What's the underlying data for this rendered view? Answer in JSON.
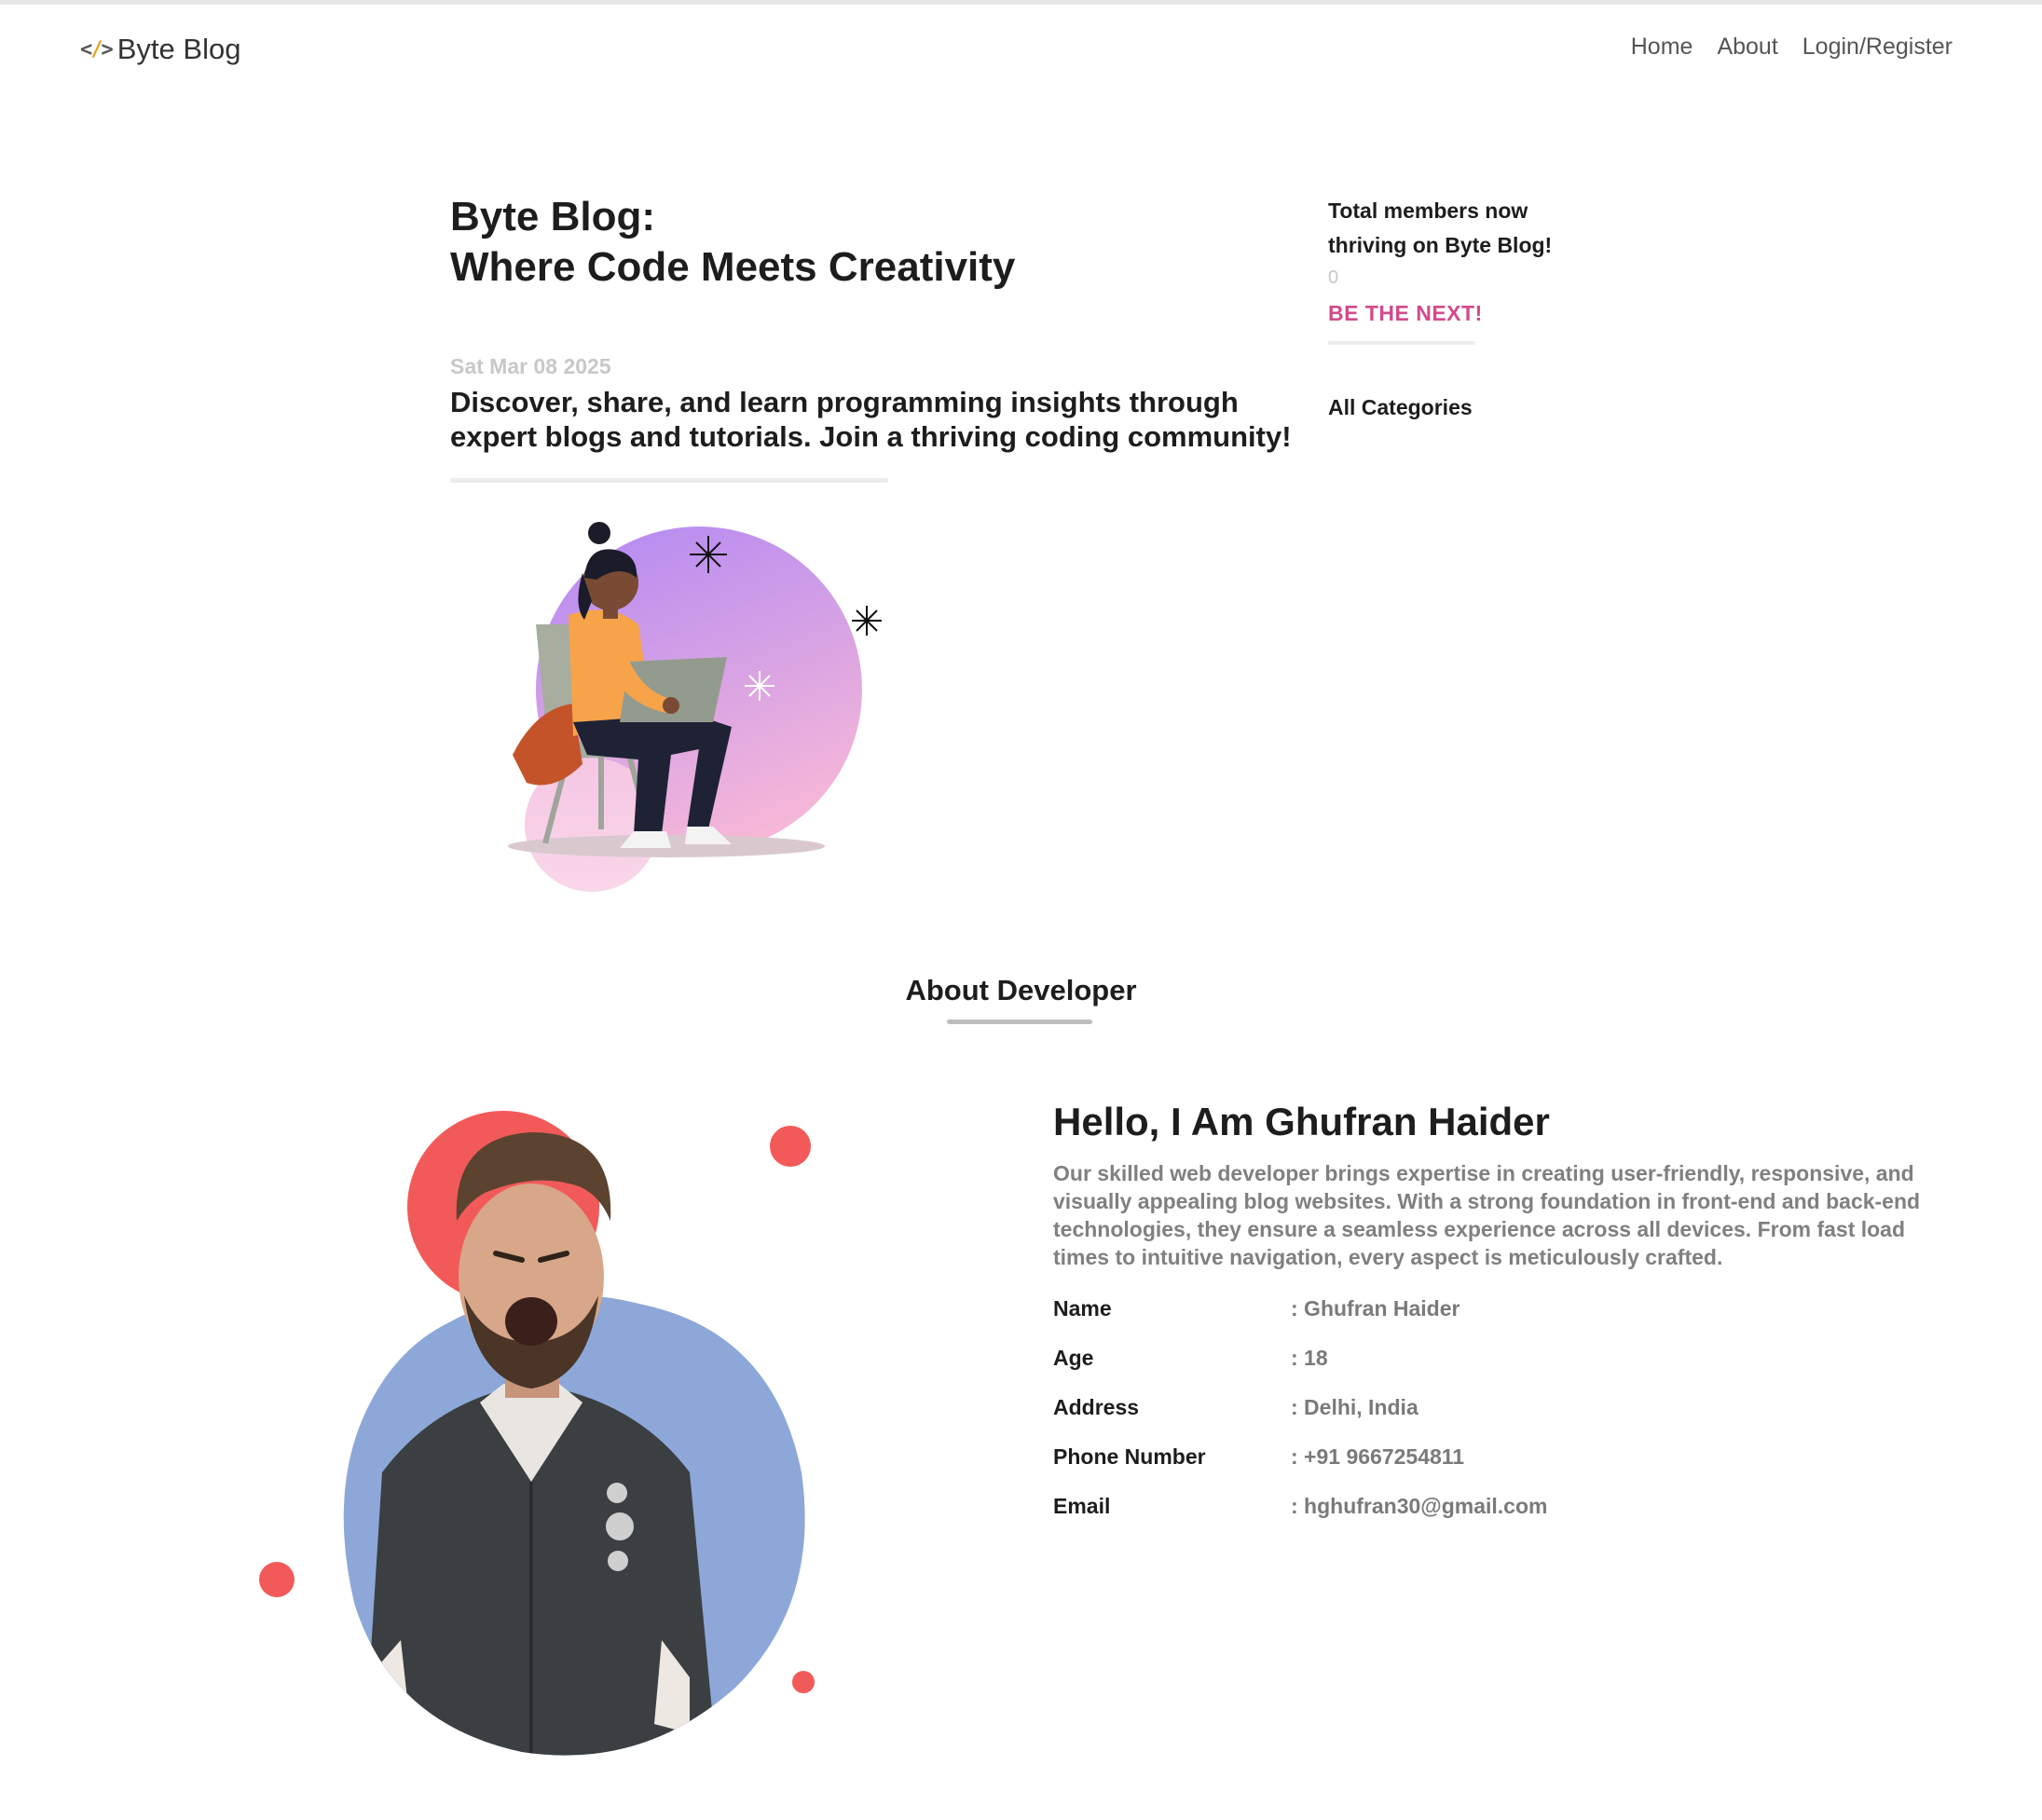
{
  "navbar": {
    "brand_icon": "</>",
    "brand_name": "Byte Blog",
    "links": [
      "Home",
      "About",
      "Login/Register"
    ]
  },
  "hero": {
    "title_line1": "Byte Blog:",
    "title_line2": "Where Code Meets Creativity",
    "date": "Sat Mar 08 2025",
    "description": "Discover, share, and learn programming insights through expert blogs and tutorials. Join a thriving coding community!"
  },
  "sidebar": {
    "members_text": "Total members now thriving on Byte Blog!",
    "members_count": "0",
    "cta": "BE THE NEXT!",
    "categories_heading": "All Categories"
  },
  "about": {
    "heading": "About Developer",
    "greeting": "Hello, I Am Ghufran Haider",
    "bio": "Our skilled web developer brings expertise in creating user-friendly, responsive, and visually appealing blog websites. With a strong foundation in front-end and back-end technologies, they ensure a seamless experience across all devices. From fast load times to intuitive navigation, every aspect is meticulously crafted.",
    "details": [
      {
        "label": "Name",
        "value": ": Ghufran Haider"
      },
      {
        "label": "Age",
        "value": ": 18"
      },
      {
        "label": "Address",
        "value": ": Delhi, India"
      },
      {
        "label": "Phone Number",
        "value": ": +91 9667254811"
      },
      {
        "label": "Email",
        "value": ": hghufran30@gmail.com"
      }
    ]
  },
  "colors": {
    "accent_pink": "#d34a8b",
    "accent_red": "#f25a5a",
    "accent_blue": "#8da8d8",
    "brand_slash": "#e3a21a"
  }
}
